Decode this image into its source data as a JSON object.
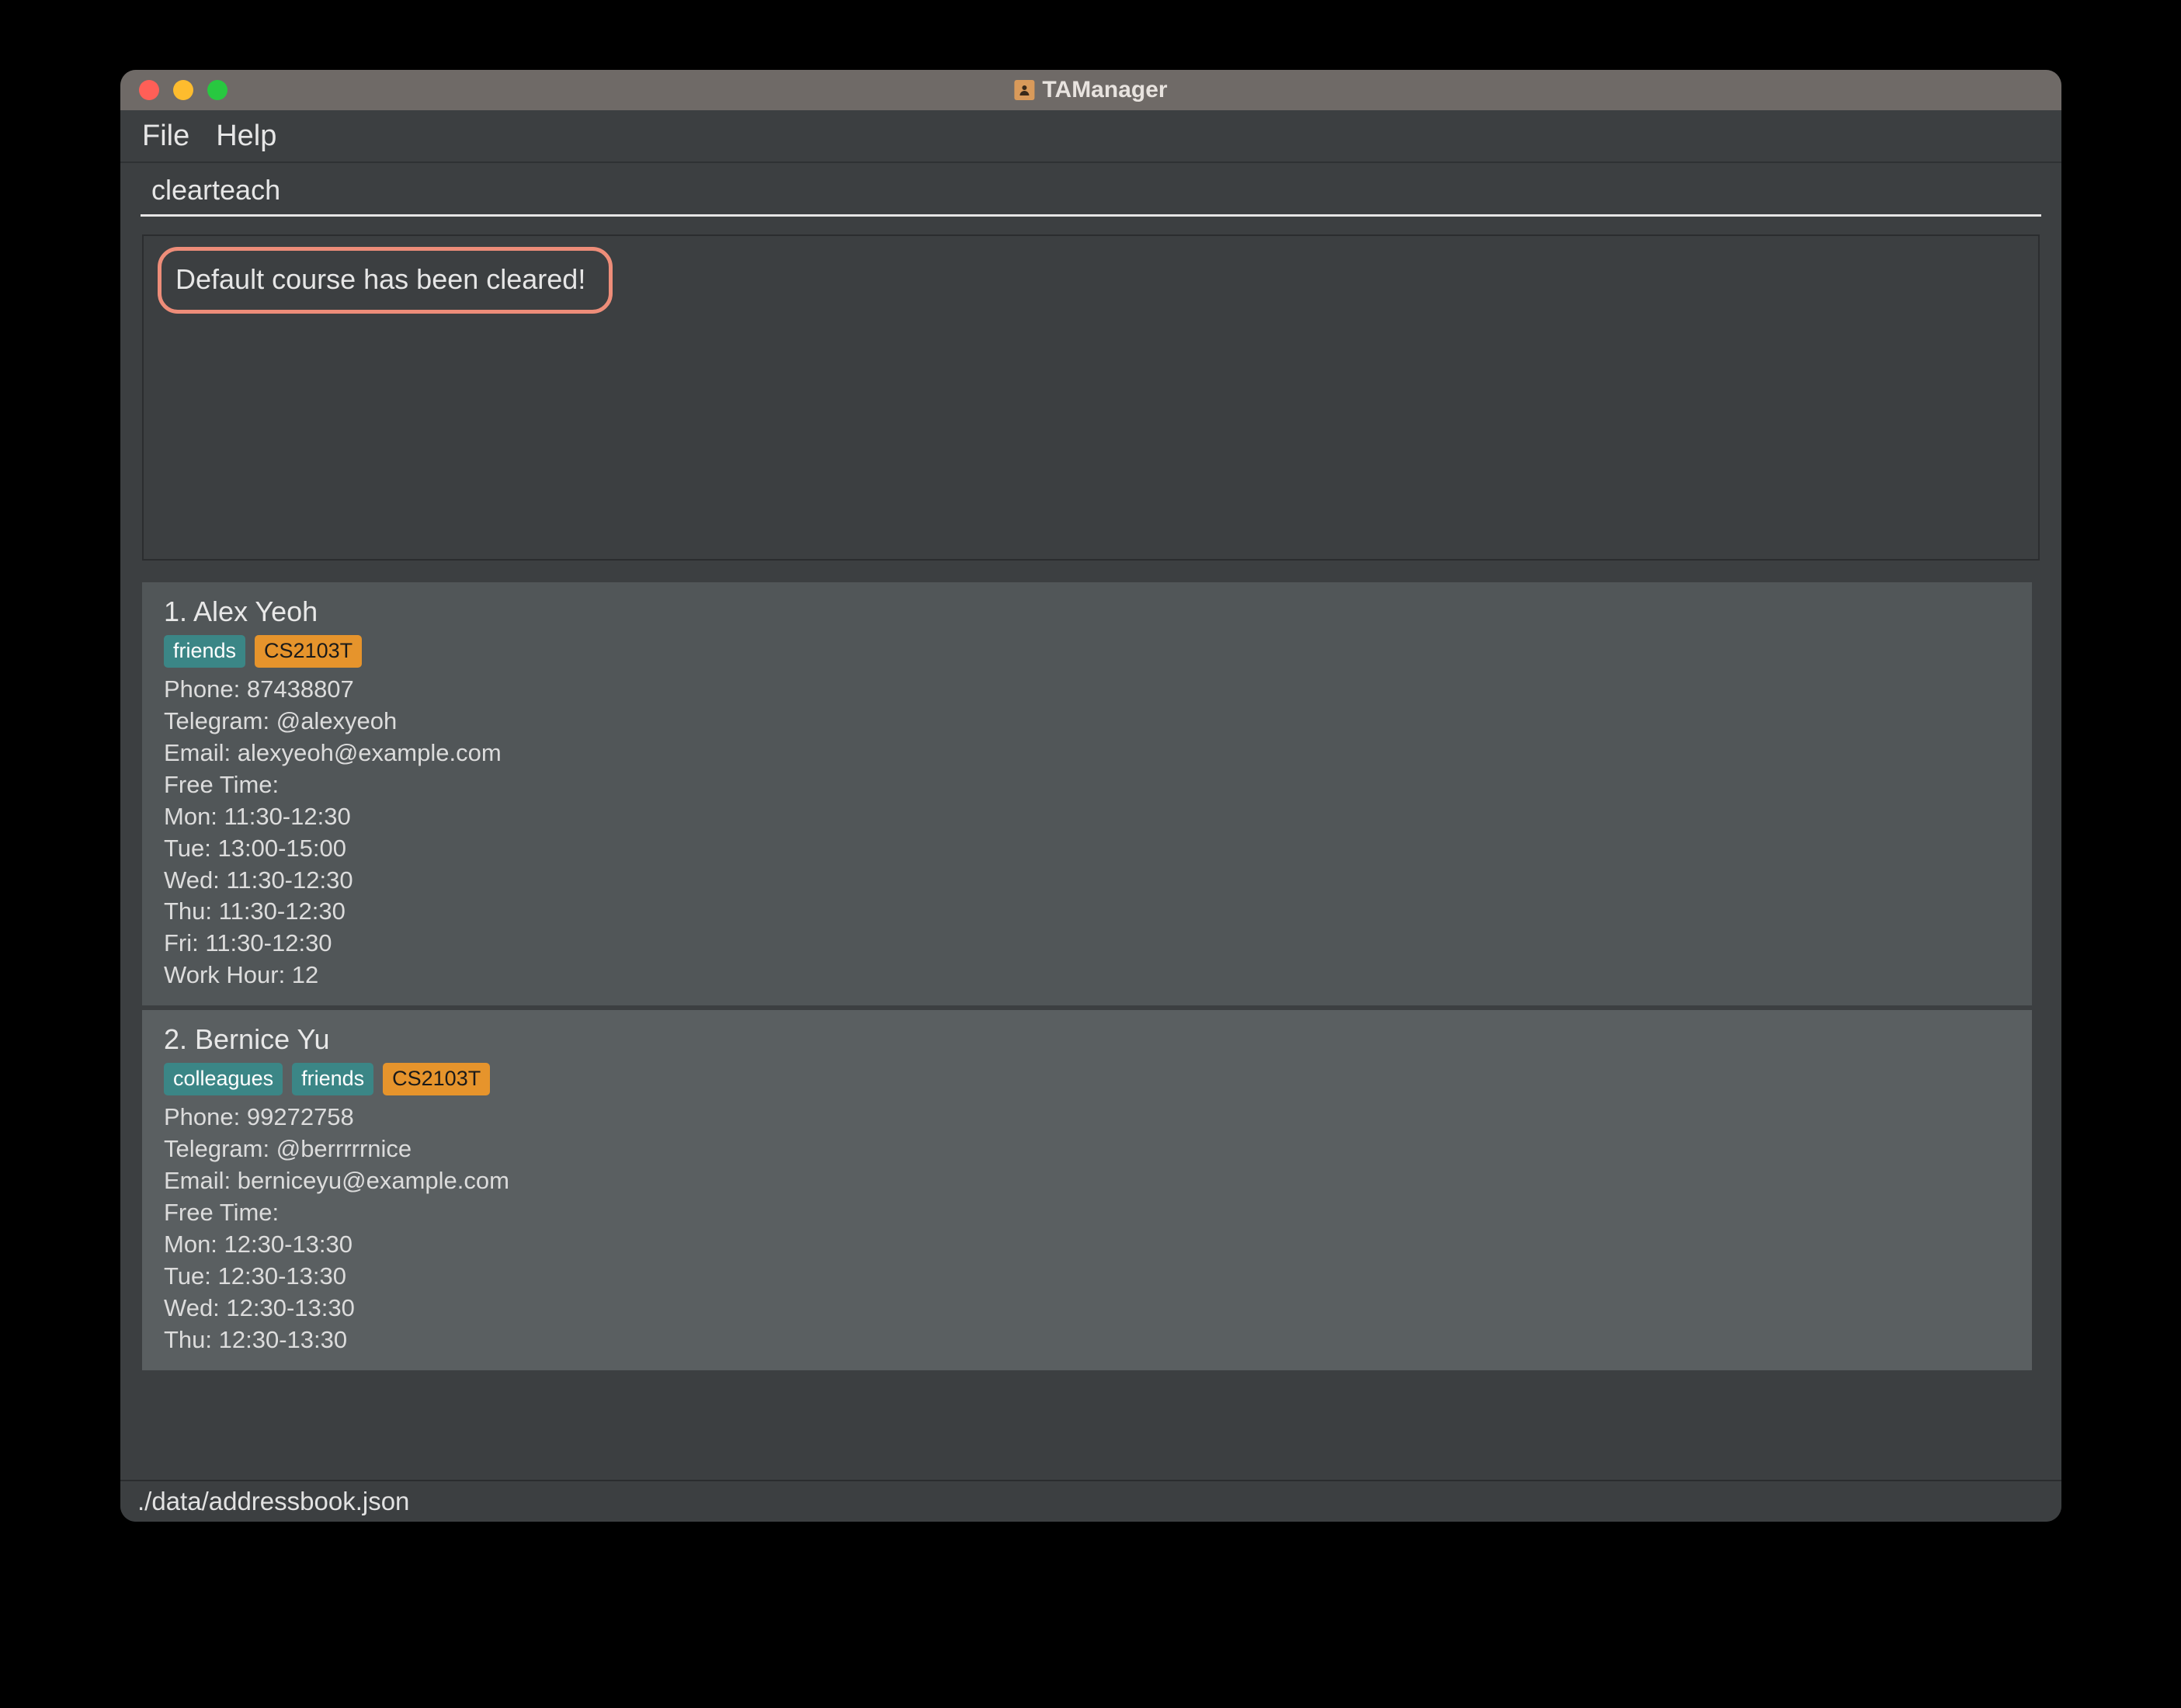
{
  "window": {
    "title": "TAManager"
  },
  "menu": {
    "file": "File",
    "help": "Help"
  },
  "command": {
    "value": "clearteach"
  },
  "result": {
    "message": "Default course has been cleared!"
  },
  "persons": [
    {
      "index": "1.",
      "name": "Alex Yeoh",
      "tags": [
        {
          "text": "friends",
          "style": "teal"
        },
        {
          "text": "CS2103T",
          "style": "orange"
        }
      ],
      "phone": "Phone: 87438807",
      "telegram": "Telegram: @alexyeoh",
      "email": "Email: alexyeoh@example.com",
      "freeTimeLabel": "Free Time:",
      "freeTimes": [
        "Mon: 11:30-12:30",
        "Tue: 13:00-15:00",
        "Wed: 11:30-12:30",
        "Thu: 11:30-12:30",
        "Fri: 11:30-12:30"
      ],
      "workHour": "Work Hour: 12"
    },
    {
      "index": "2.",
      "name": "Bernice Yu",
      "tags": [
        {
          "text": "colleagues",
          "style": "teal"
        },
        {
          "text": "friends",
          "style": "teal"
        },
        {
          "text": "CS2103T",
          "style": "orange"
        }
      ],
      "phone": "Phone: 99272758",
      "telegram": "Telegram: @berrrrrnice",
      "email": "Email: berniceyu@example.com",
      "freeTimeLabel": "Free Time:",
      "freeTimes": [
        "Mon: 12:30-13:30",
        "Tue: 12:30-13:30",
        "Wed: 12:30-13:30",
        "Thu: 12:30-13:30"
      ],
      "workHour": ""
    }
  ],
  "statusbar": {
    "path": "./data/addressbook.json"
  }
}
